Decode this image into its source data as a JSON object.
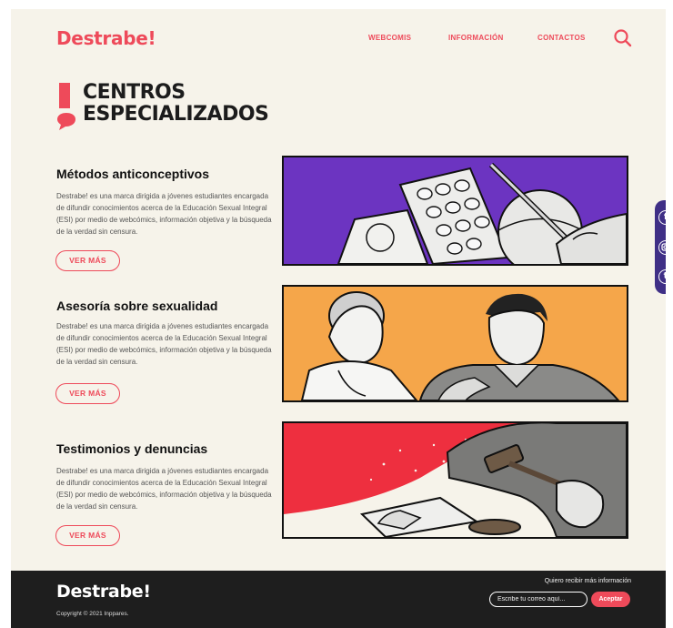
{
  "brand": {
    "logo": "Destrabe!",
    "accent": "#ee4a5a"
  },
  "nav": {
    "items": [
      "WEBCOMIS",
      "INFORMACIÓN",
      "CONTACTOS"
    ]
  },
  "page": {
    "title_line1": "CENTROS",
    "title_line2": "ESPECIALIZADOS"
  },
  "sections": [
    {
      "title": "Métodos anticonceptivos",
      "text": "Destrabe! es una marca dirigida a jóvenes estudiantes encargada de difundir conocimientos acerca de la Educación Sexual Integral (ESI) por medio de webcómics, información objetiva y la búsqueda de la verdad sin censura.",
      "button": "VER MÁS",
      "illustration_bg": "#6c34c1"
    },
    {
      "title": "Asesoría sobre sexualidad",
      "text": "Destrabe! es una marca dirigida a jóvenes estudiantes encargada de difundir conocimientos acerca de la Educación Sexual Integral (ESI) por medio de webcómics, información objetiva y la búsqueda de la verdad sin censura.",
      "button": "VER MÁS",
      "illustration_bg": "#f5a64a"
    },
    {
      "title": "Testimonios y denuncias",
      "text": "Destrabe! es una marca dirigida a jóvenes estudiantes encargada de difundir conocimientos acerca de la Educación Sexual Integral (ESI) por medio de webcómics, información objetiva y la búsqueda de la verdad sin censura.",
      "button": "VER MÁS",
      "illustration_bg": "#ee2f3f"
    }
  ],
  "social": {
    "icons": [
      "facebook-icon",
      "instagram-icon",
      "tumblr-icon"
    ],
    "bg": "#3f2f86"
  },
  "footer": {
    "logo": "Destrabe!",
    "copyright": "Copyright © 2021 Inppares.",
    "newsletter_label": "Quiero recibir más información",
    "email_placeholder": "Escribe tu correo aquí...",
    "submit_label": "Aceptar"
  }
}
